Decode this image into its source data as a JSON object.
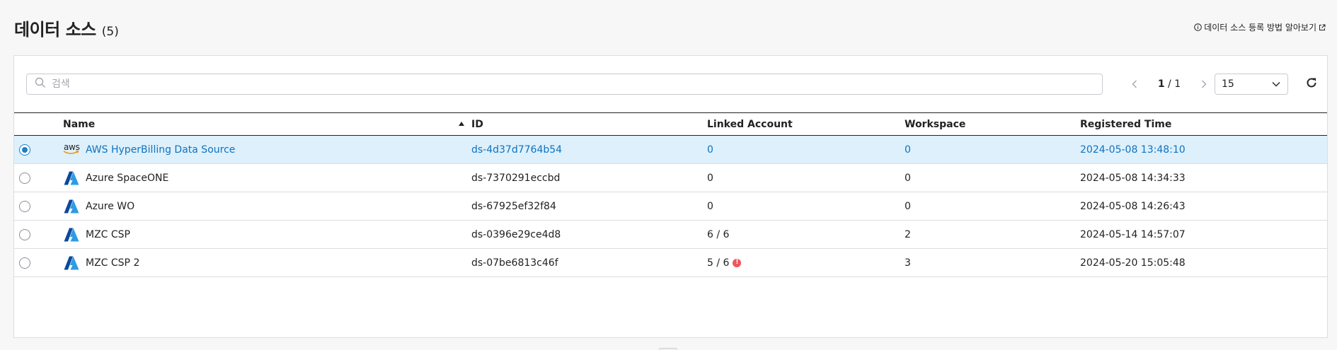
{
  "header": {
    "title": "데이터 소스",
    "count": "(5)",
    "help_label": "데이터 소스 등록 방법 알아보기"
  },
  "toolbar": {
    "search_placeholder": "검색",
    "search_value": "",
    "page_current": "1",
    "page_sep": " / ",
    "page_total": "1",
    "page_size": "15"
  },
  "table": {
    "columns": {
      "name": "Name",
      "id": "ID",
      "linked_account": "Linked Account",
      "workspace": "Workspace",
      "registered_time": "Registered Time"
    },
    "sort": {
      "column": "name",
      "direction": "ascending"
    },
    "rows": [
      {
        "selected": true,
        "provider_icon": "aws-logo-icon",
        "name": "AWS HyperBilling Data Source",
        "id": "ds-4d37d7764b54",
        "linked_account": "0",
        "linked_warning": false,
        "workspace": "0",
        "registered_time": "2024-05-08 13:48:10"
      },
      {
        "selected": false,
        "provider_icon": "azure-logo-icon",
        "name": "Azure SpaceONE",
        "id": "ds-7370291eccbd",
        "linked_account": "0",
        "linked_warning": false,
        "workspace": "0",
        "registered_time": "2024-05-08 14:34:33"
      },
      {
        "selected": false,
        "provider_icon": "azure-logo-icon",
        "name": "Azure WO",
        "id": "ds-67925ef32f84",
        "linked_account": "0",
        "linked_warning": false,
        "workspace": "0",
        "registered_time": "2024-05-08 14:26:43"
      },
      {
        "selected": false,
        "provider_icon": "azure-logo-icon",
        "name": "MZC CSP",
        "id": "ds-0396e29ce4d8",
        "linked_account": "6 / 6",
        "linked_warning": false,
        "workspace": "2",
        "registered_time": "2024-05-14 14:57:07"
      },
      {
        "selected": false,
        "provider_icon": "azure-logo-icon",
        "name": "MZC CSP 2",
        "id": "ds-07be6813c46f",
        "linked_account": "5 / 6",
        "linked_warning": true,
        "workspace": "3",
        "registered_time": "2024-05-20 15:05:48"
      }
    ]
  },
  "icons": {
    "aws_logo_text": "aws",
    "warning_glyph": "!"
  },
  "colors": {
    "accent": "#1a80c9",
    "selected_row_bg": "#ddf0fb",
    "selected_text": "#0f72bf",
    "warning": "#f0555a",
    "azure_dark": "#0a4a9c",
    "azure_light": "#2f9be6",
    "aws_orange": "#f29100"
  }
}
